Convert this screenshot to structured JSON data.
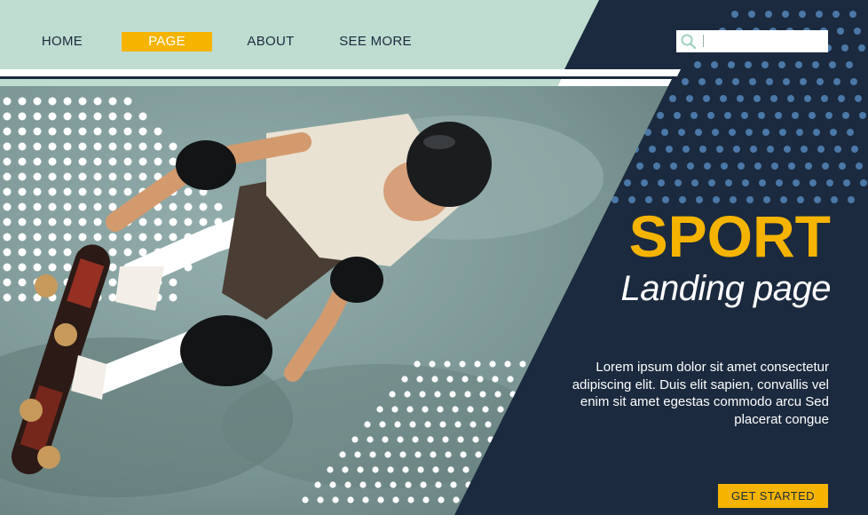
{
  "nav": {
    "items": [
      {
        "label": "HOME",
        "active": false
      },
      {
        "label": "PAGE",
        "active": true
      },
      {
        "label": "ABOUT",
        "active": false
      },
      {
        "label": "SEE MORE",
        "active": false
      }
    ]
  },
  "search": {
    "placeholder": "",
    "value": ""
  },
  "hero": {
    "title": "SPORT",
    "subtitle": "Landing page",
    "body": "Lorem ipsum dolor sit amet consectetur adipiscing elit. Duis elit sapien, convallis vel enim sit amet egestas commodo arcu Sed placerat congue",
    "cta_label": "GET STARTED"
  },
  "colors": {
    "navy": "#1b2a3e",
    "mint": "#bfdcd1",
    "accent_yellow": "#f5b400",
    "dot_blue": "#4a78a8",
    "photo_sky": "#7f9a98"
  },
  "icons": {
    "search": "search-icon"
  }
}
